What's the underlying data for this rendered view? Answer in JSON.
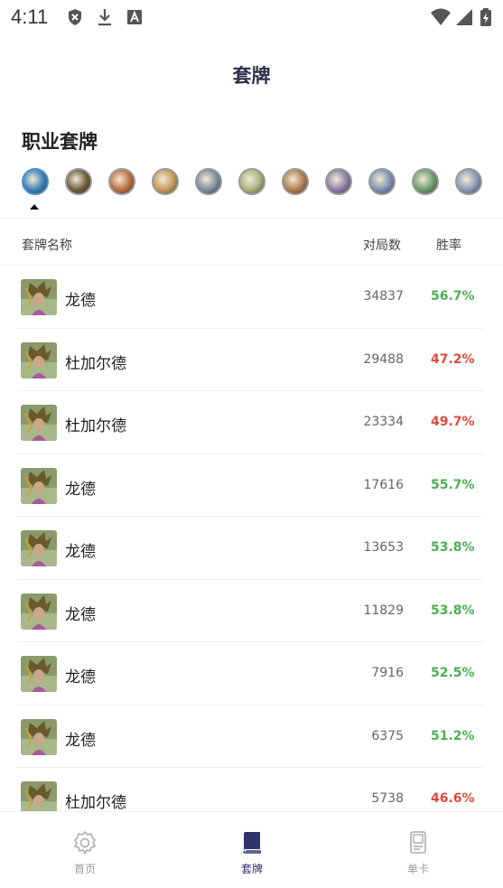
{
  "status_bar": {
    "time": "4:11",
    "icons": [
      "shield-x-icon",
      "download-icon",
      "font-a-icon",
      "wifi-icon",
      "signal-icon",
      "battery-charging-icon"
    ]
  },
  "header": {
    "title": "套牌"
  },
  "section": {
    "title": "职业套牌"
  },
  "classes": [
    {
      "icon": "death-knight-icon",
      "color": "#3a7fb5",
      "active": true
    },
    {
      "icon": "demon-hunter-icon",
      "color": "#6b5a3a",
      "active": false
    },
    {
      "icon": "druid-icon",
      "color": "#b86a3a",
      "active": false
    },
    {
      "icon": "hunter-icon",
      "color": "#c49a5a",
      "active": false
    },
    {
      "icon": "mage-icon",
      "color": "#7a8a9a",
      "active": false
    },
    {
      "icon": "paladin-icon",
      "color": "#a8b07a",
      "active": false
    },
    {
      "icon": "priest-icon",
      "color": "#b07a4a",
      "active": false
    },
    {
      "icon": "rogue-icon",
      "color": "#8a7aa8",
      "active": false
    },
    {
      "icon": "shaman-icon",
      "color": "#7a90b0",
      "active": false
    },
    {
      "icon": "warlock-icon",
      "color": "#6a9a6a",
      "active": false
    },
    {
      "icon": "warrior-icon",
      "color": "#8a96b8",
      "active": false
    }
  ],
  "table": {
    "headers": {
      "name": "套牌名称",
      "games": "对局数",
      "win_rate": "胜率"
    },
    "rows": [
      {
        "name": "龙德",
        "games": "34837",
        "win_rate": "56.7%",
        "good": true
      },
      {
        "name": "杜加尔德",
        "games": "29488",
        "win_rate": "47.2%",
        "good": false
      },
      {
        "name": "杜加尔德",
        "games": "23334",
        "win_rate": "49.7%",
        "good": false
      },
      {
        "name": "龙德",
        "games": "17616",
        "win_rate": "55.7%",
        "good": true
      },
      {
        "name": "龙德",
        "games": "13653",
        "win_rate": "53.8%",
        "good": true
      },
      {
        "name": "龙德",
        "games": "11829",
        "win_rate": "53.8%",
        "good": true
      },
      {
        "name": "龙德",
        "games": "7916",
        "win_rate": "52.5%",
        "good": true
      },
      {
        "name": "龙德",
        "games": "6375",
        "win_rate": "51.2%",
        "good": true
      },
      {
        "name": "杜加尔德",
        "games": "5738",
        "win_rate": "46.6%",
        "good": false
      }
    ]
  },
  "bottom_nav": {
    "home": "首页",
    "decks": "套牌",
    "cards": "单卡"
  },
  "colors": {
    "win_good": "#4caf50",
    "win_bad": "#e04a3c",
    "accent": "#2f3470"
  }
}
